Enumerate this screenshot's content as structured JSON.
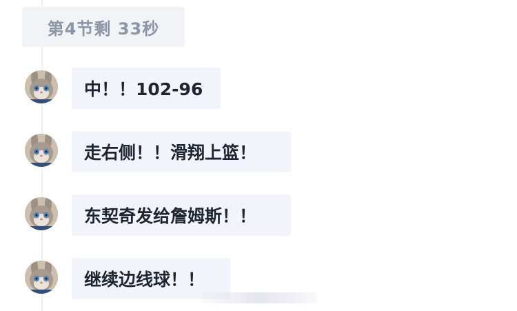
{
  "period_chip": {
    "label": "第4节剩 33秒"
  },
  "messages": [
    {
      "text": "中！！102-96",
      "avatar": "judy-hopps-avatar"
    },
    {
      "text": "走右侧！！滑翔上篮！",
      "avatar": "judy-hopps-avatar"
    },
    {
      "text": "东契奇发给詹姆斯！！",
      "avatar": "judy-hopps-avatar"
    },
    {
      "text": "继续边线球！！",
      "avatar": "judy-hopps-avatar"
    }
  ],
  "colors": {
    "bubble_bg": "#f2f4fb",
    "chip_bg": "#f2f3f7",
    "chip_text": "#8c95a8",
    "message_text": "#1f2530",
    "timeline": "#eef0f4"
  }
}
